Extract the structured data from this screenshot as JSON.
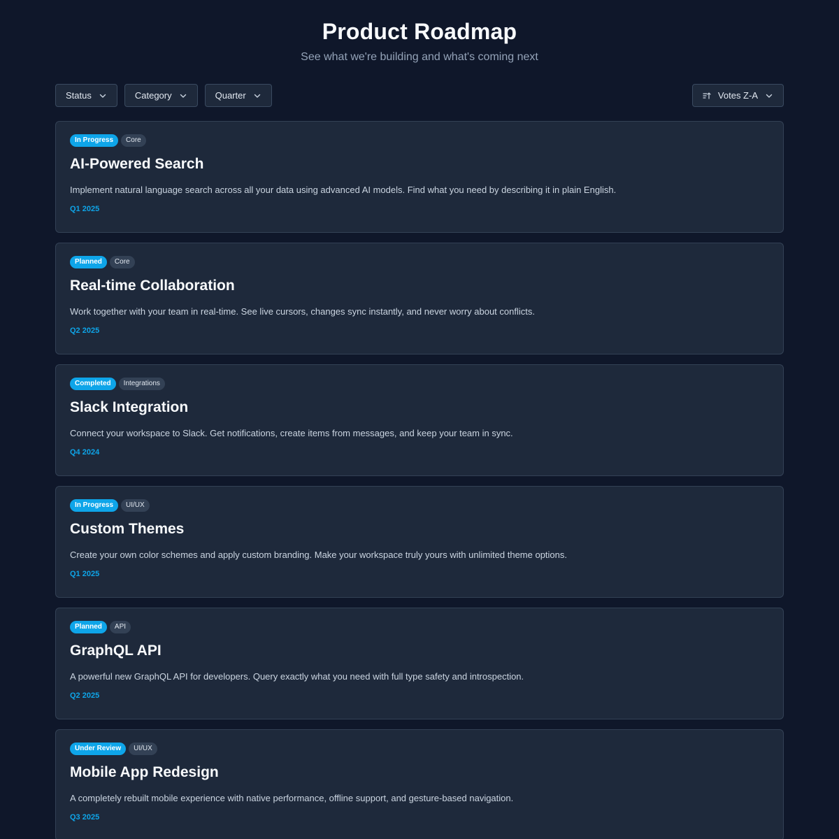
{
  "header": {
    "title": "Product Roadmap",
    "subtitle": "See what we're building and what's coming next"
  },
  "filters": {
    "status_label": "Status",
    "category_label": "Category",
    "quarter_label": "Quarter"
  },
  "sort": {
    "label": "Votes Z-A",
    "icon": "sort-icon"
  },
  "colors": {
    "background": "#0f172a",
    "card": "#1e293b",
    "accent": "#0ea5e9"
  },
  "items": [
    {
      "status": "In Progress",
      "category": "Core",
      "title": "AI-Powered Search",
      "description": "Implement natural language search across all your data using advanced AI models. Find what you need by describing it in plain English.",
      "quarter": "Q1 2025"
    },
    {
      "status": "Planned",
      "category": "Core",
      "title": "Real-time Collaboration",
      "description": "Work together with your team in real-time. See live cursors, changes sync instantly, and never worry about conflicts.",
      "quarter": "Q2 2025"
    },
    {
      "status": "Completed",
      "category": "Integrations",
      "title": "Slack Integration",
      "description": "Connect your workspace to Slack. Get notifications, create items from messages, and keep your team in sync.",
      "quarter": "Q4 2024"
    },
    {
      "status": "In Progress",
      "category": "UI/UX",
      "title": "Custom Themes",
      "description": "Create your own color schemes and apply custom branding. Make your workspace truly yours with unlimited theme options.",
      "quarter": "Q1 2025"
    },
    {
      "status": "Planned",
      "category": "API",
      "title": "GraphQL API",
      "description": "A powerful new GraphQL API for developers. Query exactly what you need with full type safety and introspection.",
      "quarter": "Q2 2025"
    },
    {
      "status": "Under Review",
      "category": "UI/UX",
      "title": "Mobile App Redesign",
      "description": "A completely rebuilt mobile experience with native performance, offline support, and gesture-based navigation.",
      "quarter": "Q3 2025"
    }
  ]
}
